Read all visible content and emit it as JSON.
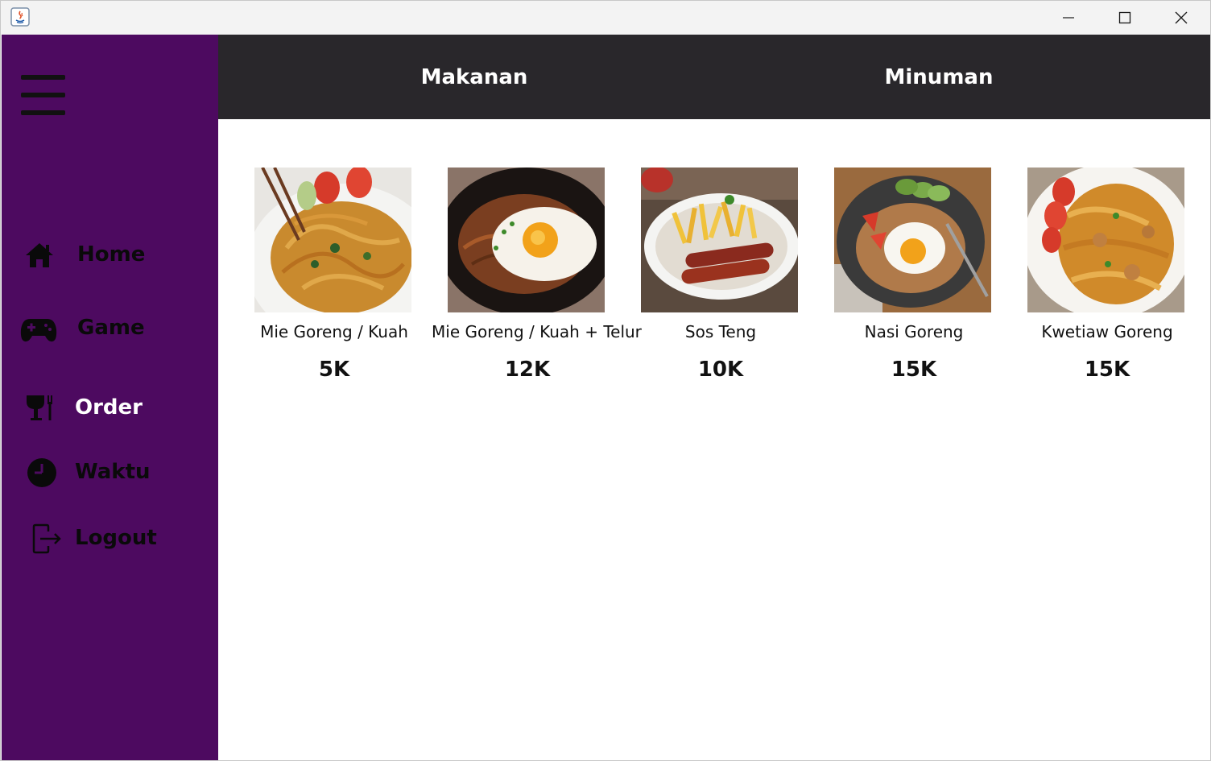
{
  "colors": {
    "sidebar_bg": "#4d0a60",
    "header_bg": "#29272b",
    "titlebar_bg": "#f3f3f3",
    "active_text": "#ffffff",
    "inactive_text": "#0a0a0a"
  },
  "titlebar": {
    "icons": [
      "java-app-icon",
      "minimize-icon",
      "maximize-icon",
      "close-icon"
    ]
  },
  "sidebar": {
    "menu_icon": "hamburger-menu-icon",
    "items": [
      {
        "label": "Home",
        "icon": "home-icon",
        "active": false
      },
      {
        "label": "Game",
        "icon": "gamepad-icon",
        "active": false
      },
      {
        "label": "Order",
        "icon": "utensils-icon",
        "active": true
      },
      {
        "label": "Waktu",
        "icon": "clock-icon",
        "active": false
      },
      {
        "label": "Logout",
        "icon": "logout-icon",
        "active": false
      }
    ]
  },
  "tabs": [
    {
      "label": "Makanan"
    },
    {
      "label": "Minuman"
    }
  ],
  "menu": [
    {
      "name": "Mie Goreng / Kuah",
      "price": "5K",
      "image": "fried-noodles-photo"
    },
    {
      "name": "Mie Goreng / Kuah + Telur",
      "price": "12K",
      "image": "noodles-with-egg-photo"
    },
    {
      "name": "Sos Teng",
      "price": "10K",
      "image": "sausage-and-fries-photo"
    },
    {
      "name": "Nasi Goreng",
      "price": "15K",
      "image": "fried-rice-photo"
    },
    {
      "name": "Kwetiaw Goreng",
      "price": "15K",
      "image": "fried-kwetiaw-photo"
    }
  ]
}
